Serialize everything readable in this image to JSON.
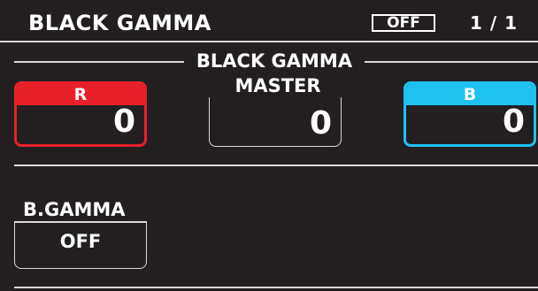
{
  "header": {
    "title": "BLACK GAMMA",
    "status": "OFF",
    "page": "1 / 1"
  },
  "section": {
    "label": "BLACK GAMMA"
  },
  "master": {
    "label": "MASTER",
    "value": "0"
  },
  "r": {
    "label": "R",
    "value": "0",
    "color": "#e8202a"
  },
  "b": {
    "label": "B",
    "value": "0",
    "color": "#1fc1ef"
  },
  "bgamma": {
    "label": "B.GAMMA",
    "value": "OFF"
  }
}
